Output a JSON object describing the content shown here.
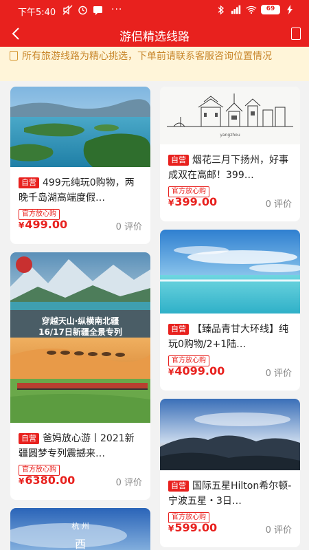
{
  "status_bar": {
    "time": "下午5:40",
    "dots": "···",
    "battery": "69"
  },
  "nav": {
    "title": "游侣精选线路"
  },
  "notice": {
    "text": "所有旅游线路为精心挑选，下单前请联系客服咨询位置情况"
  },
  "common": {
    "self_tag": "自营",
    "official_tag": "官方放心购",
    "currency": "¥"
  },
  "products": [
    {
      "title": "499元纯玩0购物，两晚千岛湖高端度假…",
      "price": "499.00",
      "reviews": "0 评价"
    },
    {
      "title": "烟花三月下扬州，好事成双在高邮！399…",
      "price": "399.00",
      "reviews": "0 评价",
      "image_text": "yangzhou"
    },
    {
      "title": "【臻品青甘大环线】纯玩0购物/2+1陆…",
      "price": "4099.00",
      "reviews": "0 评价"
    },
    {
      "title": "爸妈放心游丨2021新疆圆梦专列震撼来…",
      "price": "6380.00",
      "reviews": "0 评价",
      "image_text_1": "穿越天山·纵横南北疆",
      "image_text_2": "16/17日新疆全景专列"
    },
    {
      "title": "国际五星Hilton希尔顿-宁波五星・3日…",
      "price": "599.00",
      "reviews": "0 评价"
    },
    {
      "image_text_1": "杭 州",
      "image_text_2": "西"
    }
  ],
  "colors": {
    "brand": "#e8211e",
    "notice_bg": "#fff5d9",
    "notice_text": "#c8862a"
  }
}
